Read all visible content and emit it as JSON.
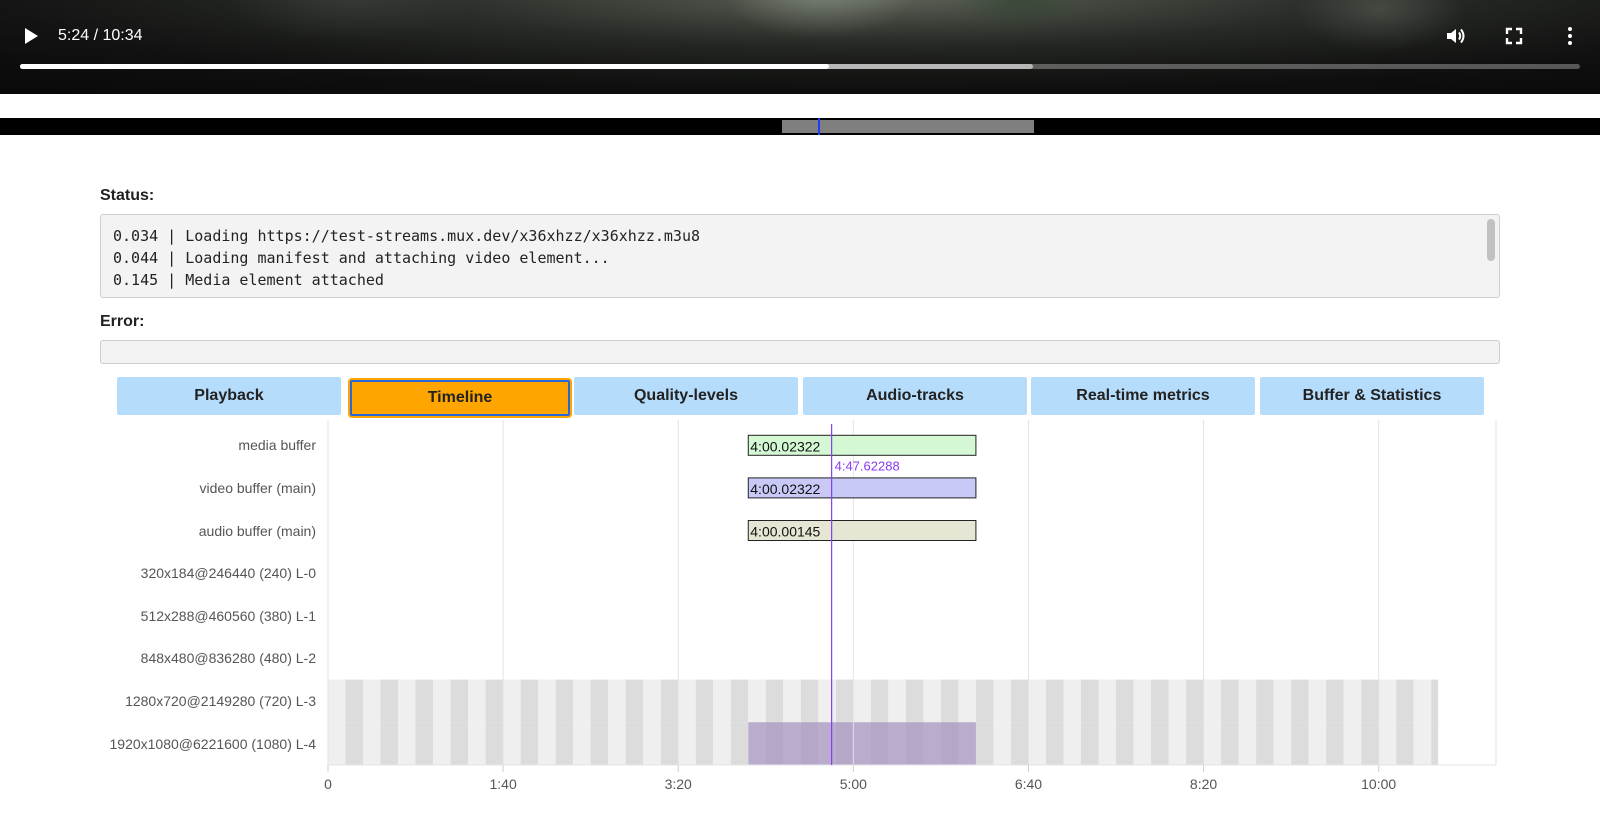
{
  "player": {
    "time_display": "5:24 / 10:34",
    "played_fraction": 0.5185,
    "buffered_fraction": 0.6495,
    "icons": [
      "play-icon",
      "volume-icon",
      "fullscreen-icon",
      "more-vert-icon"
    ]
  },
  "minibar": {
    "buffer_start_fraction": 0.489,
    "buffer_end_fraction": 0.646,
    "cursor_fraction": 0.511
  },
  "status": {
    "label": "Status:",
    "lines": [
      "0.034 | Loading https://test-streams.mux.dev/x36xhzz/x36xhzz.m3u8",
      "0.044 | Loading manifest and attaching video element...",
      "0.145 | Media element attached"
    ]
  },
  "error": {
    "label": "Error:",
    "value": ""
  },
  "tabs": [
    {
      "label": "Playback",
      "active": false
    },
    {
      "label": "Timeline",
      "active": true
    },
    {
      "label": "Quality-levels",
      "active": false
    },
    {
      "label": "Audio-tracks",
      "active": false
    },
    {
      "label": "Real-time metrics",
      "active": false
    },
    {
      "label": "Buffer & Statistics",
      "active": false
    }
  ],
  "colors": {
    "tab_bg": "#b6dcfb",
    "tab_active_bg": "#ffa500",
    "tab_active_border": "#2b66d6",
    "cursor_line": "#8a3cf0",
    "media_buffer_fill": "#d4f8d4",
    "video_buffer_fill": "#c9c9f7",
    "audio_buffer_fill": "#e6e6d4",
    "fragment_light": "#efefef",
    "fragment_dark": "#dcdcdc",
    "loaded_fragment": "#a896c0"
  },
  "chart_data": {
    "type": "timeline",
    "x_unit": "seconds",
    "xlim": [
      0,
      667
    ],
    "x_ticks": [
      {
        "value": 0,
        "label": "0"
      },
      {
        "value": 100,
        "label": "1:40"
      },
      {
        "value": 200,
        "label": "3:20"
      },
      {
        "value": 300,
        "label": "5:00"
      },
      {
        "value": 400,
        "label": "6:40"
      },
      {
        "value": 500,
        "label": "8:20"
      },
      {
        "value": 600,
        "label": "10:00"
      }
    ],
    "rows": [
      "media buffer",
      "video buffer (main)",
      "audio buffer (main)",
      "320x184@246440 (240) L-0",
      "512x288@460560 (380) L-1",
      "848x480@836280 (480) L-2",
      "1280x720@2149280 (720) L-3",
      "1920x1080@6221600 (1080) L-4"
    ],
    "buffers": [
      {
        "row": 0,
        "start": 240.0,
        "end": 370.0,
        "label": "4:00.02322"
      },
      {
        "row": 1,
        "start": 240.0,
        "end": 370.0,
        "label": "4:00.02322"
      },
      {
        "row": 2,
        "start": 240.0,
        "end": 370.0,
        "label": "4:00.00145"
      }
    ],
    "current_time": {
      "value": 287.6,
      "label": "4:47.62288"
    },
    "fragment_duration": 10,
    "fragments_start": 0,
    "fragments_end": 634,
    "fragment_rows": [
      6,
      7
    ],
    "loaded_fragments": {
      "row": 7,
      "start": 240.0,
      "end": 370.0
    }
  }
}
